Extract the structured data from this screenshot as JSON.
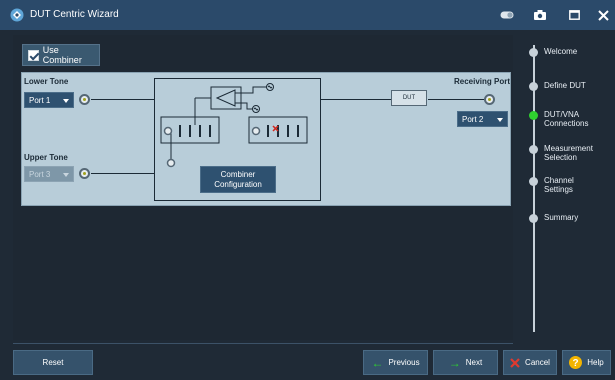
{
  "window": {
    "title": "DUT Centric Wizard"
  },
  "toolbar": {
    "use_combiner_label": "Use Combiner"
  },
  "diagram": {
    "lower_tone_label": "Lower Tone",
    "upper_tone_label": "Upper Tone",
    "receiving_port_label": "Receiving Port",
    "lower_port": "Port 1",
    "upper_port": "Port 3",
    "receiving_port": "Port 2",
    "dut_label": "DUT",
    "combiner_config_label": "Combiner Configuration"
  },
  "steps": [
    {
      "label": "Welcome",
      "active": false
    },
    {
      "label": "Define DUT",
      "active": false
    },
    {
      "label": "DUT/VNA Connections",
      "active": true
    },
    {
      "label": "Measurement Selection",
      "active": false
    },
    {
      "label": "Channel Settings",
      "active": false
    },
    {
      "label": "Summary",
      "active": false
    }
  ],
  "footer": {
    "reset": "Reset",
    "previous": "Previous",
    "next": "Next",
    "cancel": "Cancel",
    "help": "Help"
  },
  "colors": {
    "accent": "#2b4a6a",
    "active_step": "#2fd12f",
    "panel": "#b8cdd9"
  }
}
